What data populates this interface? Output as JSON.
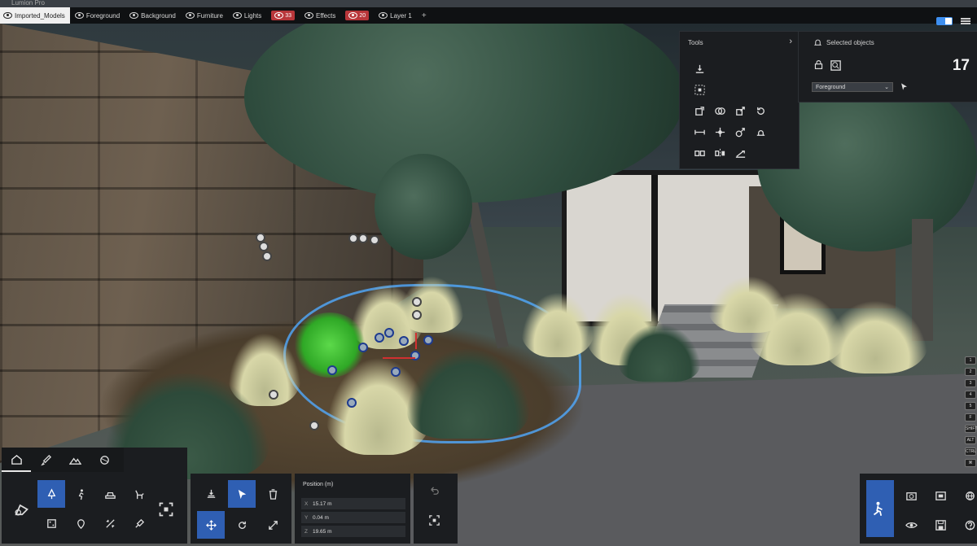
{
  "titlebar": {
    "title": "Lumion Pro"
  },
  "layers": [
    {
      "label": "Imported_Models",
      "active": true
    },
    {
      "label": "Foreground",
      "active": false
    },
    {
      "label": "Background",
      "active": false
    },
    {
      "label": "Furniture",
      "active": false
    },
    {
      "label": "Lights",
      "active": false
    },
    {
      "badge": "33",
      "badge_color": "#b8363a"
    },
    {
      "label": "Effects",
      "active": false
    },
    {
      "badge": "20",
      "badge_color": "#b8363a"
    },
    {
      "label": "Layer 1",
      "active": false
    }
  ],
  "add_layer_label": "+",
  "tools_panel": {
    "title": "Tools",
    "expand_icon": "chevron-right-icon",
    "rows": [
      [
        "fit-to-surface-icon"
      ],
      [
        "select-area-icon"
      ],
      [
        "copy-place-icon",
        "paint-icon",
        "move-out-icon",
        "rotate-icon"
      ],
      [
        "align-icon",
        "snap-icon",
        "scale-icon",
        "height-icon"
      ],
      [
        "replace-icon",
        "mirror-icon",
        "slope-icon"
      ]
    ]
  },
  "selected_panel": {
    "title": "Selected objects",
    "count": "17",
    "layer_select": "Foreground",
    "icons": [
      "bell-icon",
      "lock-icon",
      "zoom-selection-icon",
      "cursor-icon"
    ]
  },
  "home_panel": {
    "tabs": [
      "home-icon",
      "brush-icon",
      "landscape-icon",
      "materials-icon"
    ],
    "grid": [
      "nature-icon",
      "person-icon",
      "car-icon",
      "animal-icon",
      "indoor-icon",
      "location-icon",
      "effects-icon",
      "light-icon"
    ]
  },
  "place_panel": {
    "tools": [
      "place-object-icon",
      "select-icon",
      "delete-icon",
      "move-icon",
      "rotate-icon",
      "resize-icon"
    ]
  },
  "position_panel": {
    "title": "Position (m)",
    "rows": [
      {
        "axis": "X",
        "value": "15.17 m"
      },
      {
        "axis": "Y",
        "value": "0.04 m"
      },
      {
        "axis": "Z",
        "value": "19.65 m"
      }
    ]
  },
  "right_panel": {
    "icons": [
      "walk-icon",
      "camera-icon",
      "movie-icon",
      "globe-icon",
      "view-icon",
      "save-icon",
      "help-icon"
    ]
  },
  "edge_labels": [
    "1",
    "2",
    "3",
    "4",
    "5",
    "F",
    "SHIFT",
    "ALT",
    "CTRL",
    "⌘"
  ]
}
